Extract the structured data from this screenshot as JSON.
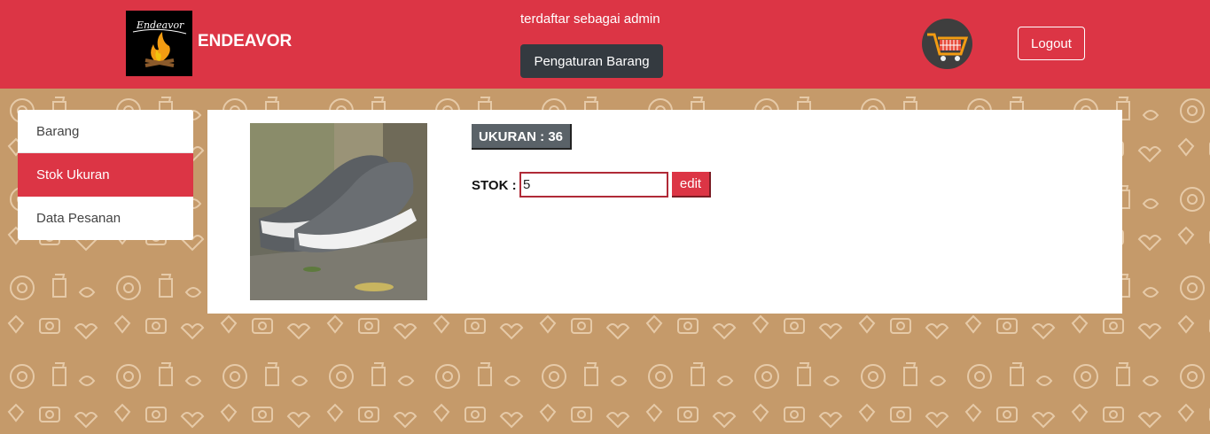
{
  "header": {
    "brand": "ENDEAVOR",
    "logo_script": "Endeavor",
    "registered_as": "terdaftar sebagai admin",
    "manage_button": "Pengaturan Barang",
    "cart_icon": "shopping-cart-icon",
    "logout_button": "Logout"
  },
  "sidebar": {
    "items": [
      {
        "label": "Barang",
        "active": false
      },
      {
        "label": "Stok Ukuran",
        "active": true
      },
      {
        "label": "Data Pesanan",
        "active": false
      }
    ]
  },
  "product": {
    "size_badge": "UKURAN : 36",
    "stock_label": "STOK :",
    "stock_value": "5",
    "edit_button": "edit"
  },
  "colors": {
    "primary": "#dc3545",
    "dark": "#343a40",
    "background": "#c59a6a"
  }
}
